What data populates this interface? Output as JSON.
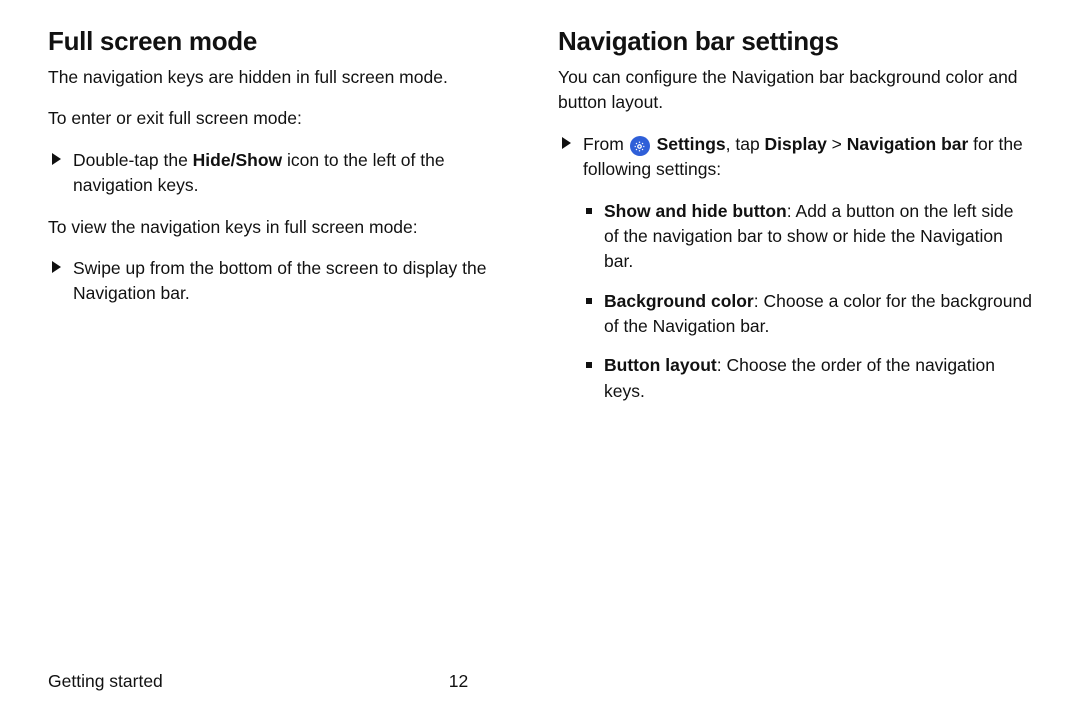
{
  "left": {
    "heading": "Full screen mode",
    "intro": "The navigation keys are hidden in full screen mode.",
    "enter_exit_label": "To enter or exit full screen mode:",
    "step1_prefix": "Double-tap the ",
    "step1_bold": "Hide/Show",
    "step1_suffix": " icon to the left of the navigation keys.",
    "view_keys_label": "To view the navigation keys in full screen mode:",
    "step2": "Swipe up from the bottom of the screen to display the Navigation bar."
  },
  "right": {
    "heading": "Navigation bar settings",
    "intro": "You can configure the Navigation bar background color and button layout.",
    "from_prefix": "From ",
    "settings_word": "Settings",
    "tap_word": ", tap ",
    "display_word": "Display",
    "chevron": " > ",
    "navbar_word": "Navigation bar",
    "from_suffix": " for the following settings:",
    "items": [
      {
        "bold": "Show and hide button",
        "rest": ": Add a button on the left side of the navigation bar to show or hide the Navigation bar."
      },
      {
        "bold": "Background color",
        "rest": ": Choose a color for the background of the Navigation bar."
      },
      {
        "bold": "Button layout",
        "rest": ": Choose the order of the navigation keys."
      }
    ]
  },
  "footer": {
    "section": "Getting started",
    "page": "12"
  }
}
